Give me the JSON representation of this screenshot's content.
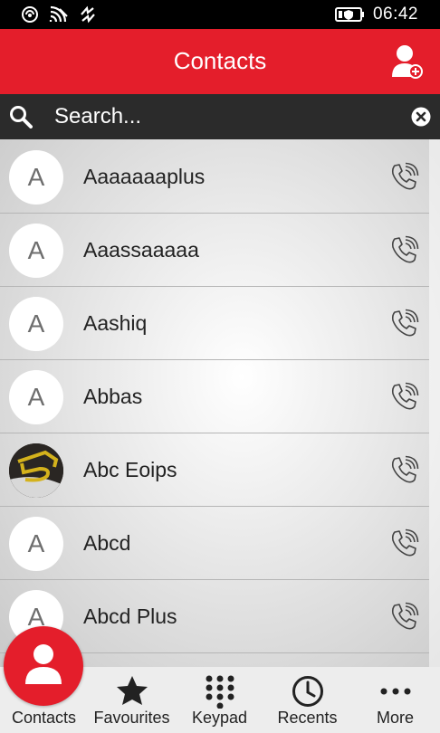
{
  "status_bar": {
    "time": "06:42",
    "icons": [
      "nfc-icon",
      "wifi-icon",
      "data-sync-icon",
      "battery-saver-icon"
    ]
  },
  "header": {
    "title": "Contacts",
    "action_icon": "add-contact-icon"
  },
  "search": {
    "placeholder": "Search..."
  },
  "contacts": [
    {
      "initial": "A",
      "name": "Aaaaaaaplus",
      "has_photo": false
    },
    {
      "initial": "A",
      "name": "Aaassaaaaa",
      "has_photo": false
    },
    {
      "initial": "A",
      "name": "Aashiq",
      "has_photo": false
    },
    {
      "initial": "A",
      "name": "Abbas",
      "has_photo": false
    },
    {
      "initial": "",
      "name": "Abc Eoips",
      "has_photo": true
    },
    {
      "initial": "A",
      "name": "Abcd",
      "has_photo": false
    },
    {
      "initial": "A",
      "name": "Abcd Plus",
      "has_photo": false
    }
  ],
  "bottom_nav": [
    {
      "label": "Contacts",
      "icon": "person-icon",
      "active": true
    },
    {
      "label": "Favourites",
      "icon": "star-icon",
      "active": false
    },
    {
      "label": "Keypad",
      "icon": "keypad-icon",
      "active": false
    },
    {
      "label": "Recents",
      "icon": "clock-icon",
      "active": false
    },
    {
      "label": "More",
      "icon": "more-dots-icon",
      "active": false
    }
  ],
  "colors": {
    "accent": "#e41e2b",
    "search_bg": "#2b2b2b",
    "nav_bg": "#ededed"
  }
}
